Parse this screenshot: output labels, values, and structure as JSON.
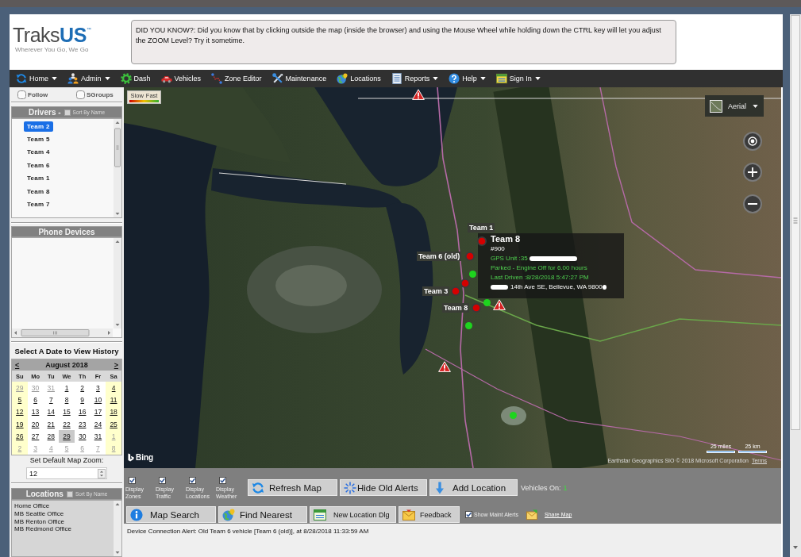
{
  "header": {
    "logo": {
      "name": "Traks",
      "accent": "US",
      "mark": "™",
      "tagline": "Wherever You Go, We Go"
    },
    "tip": "DID YOU KNOW?: Did you know that by clicking outside the map (inside the browser) and using the Mouse Wheel while holding down the CTRL key will let you adjust the ZOOM Level? Try it sometime."
  },
  "nav": [
    {
      "label": "Home",
      "dropdown": true
    },
    {
      "label": "Admin",
      "dropdown": true
    },
    {
      "label": "Dash",
      "dropdown": false
    },
    {
      "label": "Vehicles",
      "dropdown": false
    },
    {
      "label": "Zone Editor",
      "dropdown": false
    },
    {
      "label": "Maintenance",
      "dropdown": false
    },
    {
      "label": "Locations",
      "dropdown": false
    },
    {
      "label": "Reports",
      "dropdown": true
    },
    {
      "label": "Help",
      "dropdown": true
    },
    {
      "label": "Sign In",
      "dropdown": true
    }
  ],
  "sidebar": {
    "options": [
      {
        "label": "Follow",
        "checked": false
      },
      {
        "label": "SGroups",
        "checked": false
      }
    ],
    "drivers": {
      "title": "Drivers -",
      "sort": {
        "label": "Sort By Name",
        "checked": false
      },
      "items": [
        {
          "label": "Team 2",
          "selected": true
        },
        {
          "label": "Team 5",
          "selected": false
        },
        {
          "label": "Team 4",
          "selected": false
        },
        {
          "label": "Team 6",
          "selected": false
        },
        {
          "label": "Team 1",
          "selected": false
        },
        {
          "label": "Team 8",
          "selected": false
        },
        {
          "label": "Team 7",
          "selected": false
        }
      ]
    },
    "phone_devices": {
      "title": "Phone Devices"
    },
    "calendar": {
      "title": "Select A Date to View History",
      "prev": "<",
      "month": "August 2018",
      "next": ">",
      "weekdays": [
        "Su",
        "Mo",
        "Tu",
        "We",
        "Th",
        "Fr",
        "Sa"
      ],
      "weeks": [
        [
          {
            "day": "29",
            "other_month": true,
            "selected": false
          },
          {
            "day": "30",
            "other_month": true,
            "selected": false
          },
          {
            "day": "31",
            "other_month": true,
            "selected": false
          },
          {
            "day": "1",
            "other_month": false,
            "selected": false
          },
          {
            "day": "2",
            "other_month": false,
            "selected": false
          },
          {
            "day": "3",
            "other_month": false,
            "selected": false
          },
          {
            "day": "4",
            "other_month": false,
            "selected": false
          }
        ],
        [
          {
            "day": "5",
            "other_month": false,
            "selected": false
          },
          {
            "day": "6",
            "other_month": false,
            "selected": false
          },
          {
            "day": "7",
            "other_month": false,
            "selected": false
          },
          {
            "day": "8",
            "other_month": false,
            "selected": false
          },
          {
            "day": "9",
            "other_month": false,
            "selected": false
          },
          {
            "day": "10",
            "other_month": false,
            "selected": false
          },
          {
            "day": "11",
            "other_month": false,
            "selected": false
          }
        ],
        [
          {
            "day": "12",
            "other_month": false,
            "selected": false
          },
          {
            "day": "13",
            "other_month": false,
            "selected": false
          },
          {
            "day": "14",
            "other_month": false,
            "selected": false
          },
          {
            "day": "15",
            "other_month": false,
            "selected": false
          },
          {
            "day": "16",
            "other_month": false,
            "selected": false
          },
          {
            "day": "17",
            "other_month": false,
            "selected": false
          },
          {
            "day": "18",
            "other_month": false,
            "selected": false
          }
        ],
        [
          {
            "day": "19",
            "other_month": false,
            "selected": false
          },
          {
            "day": "20",
            "other_month": false,
            "selected": false
          },
          {
            "day": "21",
            "other_month": false,
            "selected": false
          },
          {
            "day": "22",
            "other_month": false,
            "selected": false
          },
          {
            "day": "23",
            "other_month": false,
            "selected": false
          },
          {
            "day": "24",
            "other_month": false,
            "selected": false
          },
          {
            "day": "25",
            "other_month": false,
            "selected": false
          }
        ],
        [
          {
            "day": "26",
            "other_month": false,
            "selected": false
          },
          {
            "day": "27",
            "other_month": false,
            "selected": false
          },
          {
            "day": "28",
            "other_month": false,
            "selected": false
          },
          {
            "day": "29",
            "other_month": false,
            "selected": true
          },
          {
            "day": "30",
            "other_month": false,
            "selected": false
          },
          {
            "day": "31",
            "other_month": false,
            "selected": false
          },
          {
            "day": "1",
            "other_month": true,
            "selected": false
          }
        ],
        [
          {
            "day": "2",
            "other_month": true,
            "selected": false
          },
          {
            "day": "3",
            "other_month": true,
            "selected": false
          },
          {
            "day": "4",
            "other_month": true,
            "selected": false
          },
          {
            "day": "5",
            "other_month": true,
            "selected": false
          },
          {
            "day": "6",
            "other_month": true,
            "selected": false
          },
          {
            "day": "7",
            "other_month": true,
            "selected": false
          },
          {
            "day": "8",
            "other_month": true,
            "selected": false
          }
        ]
      ]
    },
    "map_zoom": {
      "label": "Set Default Map Zoom:",
      "value": "12"
    },
    "locations": {
      "title": "Locations",
      "sort": {
        "label": "Sort By Name",
        "checked": false
      },
      "items": [
        "Home Office",
        "MB Seattle Office",
        "MB Renton Office",
        "MB Redmond Office"
      ]
    }
  },
  "map": {
    "legend": {
      "slow": "Slow",
      "fast": "Fast"
    },
    "map_type": "Aerial",
    "markers": [
      {
        "kind": "vehicle",
        "color": "#d50000",
        "label": "Team 1"
      },
      {
        "kind": "vehicle",
        "color": "#d50000",
        "label": "Team 6 (old)"
      },
      {
        "kind": "vehicle",
        "color": "#d50000"
      },
      {
        "kind": "vehicle",
        "color": "#d50000",
        "label": "Team 3"
      },
      {
        "kind": "vehicle",
        "color": "#d50000",
        "label": "Team 8"
      },
      {
        "kind": "dot",
        "color": "#1ed41e"
      },
      {
        "kind": "dot",
        "color": "#1ed41e"
      },
      {
        "kind": "dot",
        "color": "#1ed41e"
      },
      {
        "kind": "dot",
        "color": "#1ed41e"
      },
      {
        "kind": "alert"
      },
      {
        "kind": "alert"
      },
      {
        "kind": "alert"
      }
    ],
    "popup": {
      "title": "Team 8",
      "number": "#900",
      "gps": "GPS Unit :35",
      "status": "Parked - Engine Off for 6.00 hours",
      "last_driven": "Last Driven :8/28/2018 5:47:27 PM",
      "address": "14th Ave SE, Bellevue, WA 9800"
    },
    "attribution": {
      "logo": "Bing",
      "scale_miles": "25 miles",
      "scale_km": "25 km",
      "copyright": "Earthstar Geographics SIO © 2018 Microsoft Corporation",
      "terms": "Terms"
    }
  },
  "toolbar": {
    "layers": [
      {
        "label": "Display Zones",
        "checked": true
      },
      {
        "label": "Display Traffic",
        "checked": true
      },
      {
        "label": "Display Locations",
        "checked": true
      },
      {
        "label": "Display Weather",
        "checked": true
      }
    ],
    "actions": [
      "Refresh Map",
      "Hide Old Alerts",
      "Add Location"
    ],
    "vehicles_on": {
      "label": "Vehicles On:",
      "count": "1"
    },
    "tools": [
      "Map Search",
      "Find Nearest",
      "New Location Dlg",
      "Feedback"
    ],
    "maint_alerts": {
      "label": "Show Maint Alerts",
      "checked": true
    },
    "share": "Share Map"
  },
  "message": "Device Connection Alert: Old Team 6 vehicle [Team 6 (old)], at 8/28/2018 11:33:59 AM"
}
